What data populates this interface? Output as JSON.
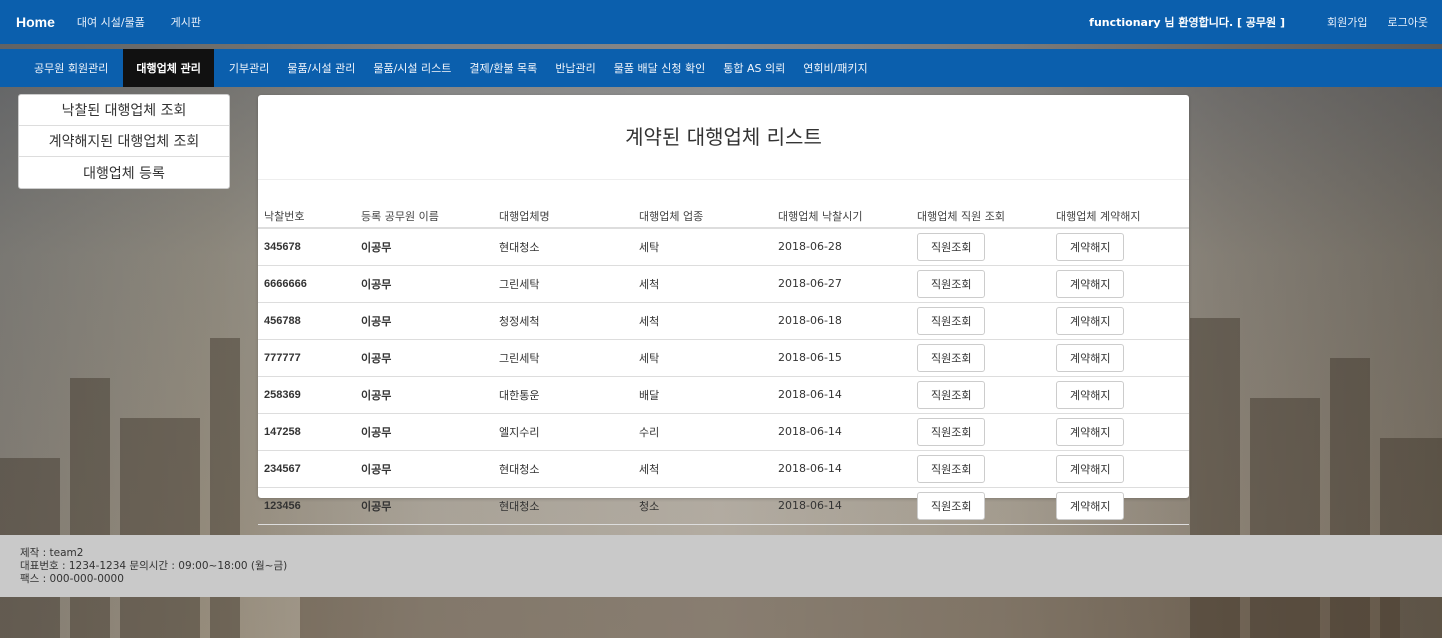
{
  "header": {
    "brand": "Home",
    "nav": [
      "대여 시설/물품",
      "게시판"
    ],
    "welcome": "functionary 님 환영합니다. [ 공무원 ]",
    "signup": "회원가입",
    "logout": "로그아웃"
  },
  "subnav": [
    {
      "label": "공무원 회원관리",
      "active": false
    },
    {
      "label": "대행업체 관리",
      "active": true
    },
    {
      "label": "기부관리",
      "active": false
    },
    {
      "label": "물품/시설 관리",
      "active": false
    },
    {
      "label": "물품/시설 리스트",
      "active": false
    },
    {
      "label": "결제/환불 목록",
      "active": false
    },
    {
      "label": "반납관리",
      "active": false
    },
    {
      "label": "물품 배달 신청 확인",
      "active": false
    },
    {
      "label": "통합 AS 의뢰",
      "active": false
    },
    {
      "label": "연회비/패키지",
      "active": false
    }
  ],
  "sidemenu": [
    "낙찰된 대행업체 조회",
    "계약해지된 대행업체 조회",
    "대행업체 등록"
  ],
  "main": {
    "title": "계약된 대행업체 리스트",
    "columns": [
      "낙찰번호",
      "등록 공무원 이름",
      "대행업체명",
      "대행업체 업종",
      "대행업체 낙찰시기",
      "대행업체 직원 조회",
      "대행업체 계약해지"
    ],
    "staff_button": "직원조회",
    "cancel_button": "계약해지",
    "rows": [
      {
        "no": "345678",
        "officer": "이공무",
        "company": "현대청소",
        "type": "세탁",
        "date": "2018-06-28"
      },
      {
        "no": "6666666",
        "officer": "이공무",
        "company": "그린세탁",
        "type": "세척",
        "date": "2018-06-27"
      },
      {
        "no": "456788",
        "officer": "이공무",
        "company": "청정세척",
        "type": "세척",
        "date": "2018-06-18"
      },
      {
        "no": "777777",
        "officer": "이공무",
        "company": "그린세탁",
        "type": "세탁",
        "date": "2018-06-15"
      },
      {
        "no": "258369",
        "officer": "이공무",
        "company": "대한통운",
        "type": "배달",
        "date": "2018-06-14"
      },
      {
        "no": "147258",
        "officer": "이공무",
        "company": "엘지수리",
        "type": "수리",
        "date": "2018-06-14"
      },
      {
        "no": "234567",
        "officer": "이공무",
        "company": "현대청소",
        "type": "세척",
        "date": "2018-06-14"
      },
      {
        "no": "123456",
        "officer": "이공무",
        "company": "현대청소",
        "type": "청소",
        "date": "2018-06-14"
      }
    ]
  },
  "footer": {
    "line1": "제작 : team2",
    "line2": "대표번호 : 1234-1234 문의시간 : 09:00~18:00 (월~금)",
    "line3": "팩스 : 000-000-0000"
  },
  "colors": {
    "nav": "#0b5fad",
    "active_tab": "#111111",
    "footer": "#c9c9c9"
  }
}
